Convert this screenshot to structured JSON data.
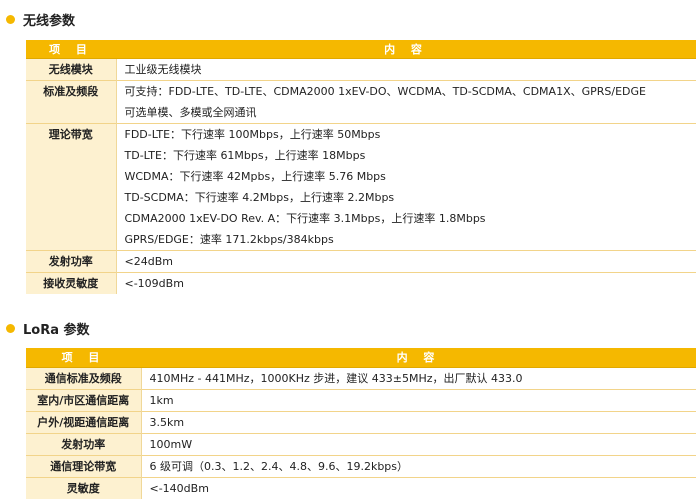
{
  "wireless": {
    "title": "无线参数",
    "header": {
      "item": "项  目",
      "content": "内  容"
    },
    "rows": [
      {
        "key": "无线模块",
        "lines": [
          "工业级无线模块"
        ]
      },
      {
        "key": "标准及频段",
        "lines": [
          "可支持：FDD-LTE、TD-LTE、CDMA2000 1xEV-DO、WCDMA、TD-SCDMA、CDMA1X、GPRS/EDGE",
          "可选单模、多模或全网通讯"
        ]
      },
      {
        "key": "理论带宽",
        "lines": [
          "FDD-LTE：下行速率 100Mbps，上行速率 50Mbps",
          "TD-LTE：下行速率 61Mbps，上行速率 18Mbps",
          "WCDMA：下行速率 42Mpbs，上行速率 5.76 Mbps",
          "TD-SCDMA：下行速率 4.2Mbps，上行速率 2.2Mbps",
          "CDMA2000 1xEV-DO Rev. A：下行速率 3.1Mbps，上行速率 1.8Mbps",
          "GPRS/EDGE：速率 171.2kbps/384kbps"
        ]
      },
      {
        "key": "发射功率",
        "lines": [
          "<24dBm"
        ]
      },
      {
        "key": "接收灵敏度",
        "lines": [
          "<-109dBm"
        ]
      }
    ]
  },
  "lora": {
    "title": "LoRa 参数",
    "header": {
      "item": "项  目",
      "content": "内  容"
    },
    "rows": [
      {
        "key": "通信标准及频段",
        "lines": [
          "410MHz - 441MHz，1000KHz 步进，建议 433±5MHz，出厂默认 433.0"
        ]
      },
      {
        "key": "室内/市区通信距离",
        "lines": [
          "1km"
        ]
      },
      {
        "key": "户外/视距通信距离",
        "lines": [
          "3.5km"
        ]
      },
      {
        "key": "发射功率",
        "lines": [
          "100mW"
        ]
      },
      {
        "key": "通信理论带宽",
        "lines": [
          "6 级可调（0.3、1.2、2.4、4.8、9.6、19.2kbps）"
        ]
      },
      {
        "key": "灵敏度",
        "lines": [
          "<-140dBm"
        ]
      }
    ]
  },
  "colors": {
    "accent": "#f5b800",
    "key_bg": "#fdf1d0"
  }
}
